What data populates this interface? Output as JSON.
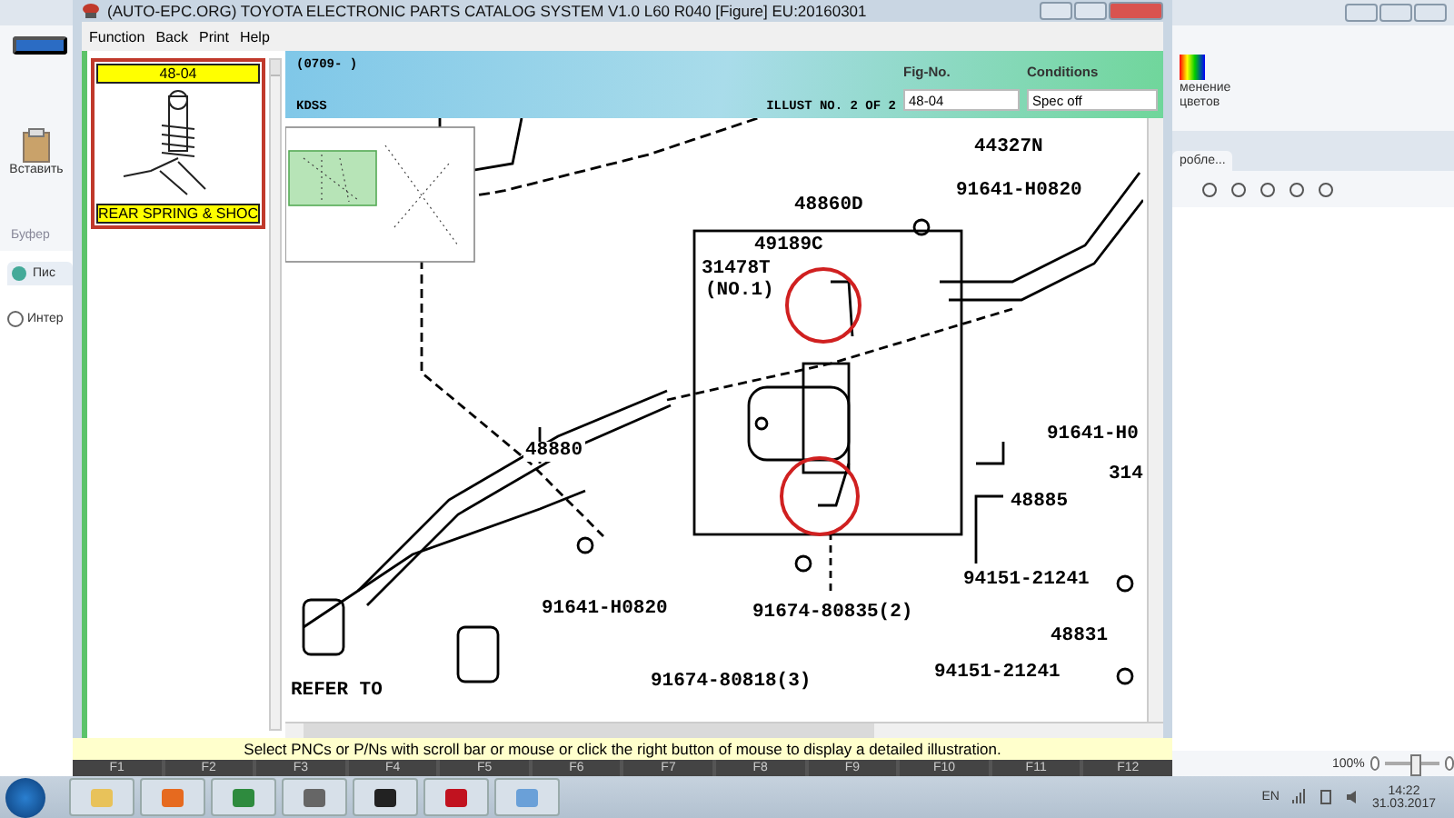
{
  "background_left": {
    "paste_label": "Вставить",
    "clipboard_label": "Буфер",
    "tab_label": "Пис",
    "address_label": "Интер"
  },
  "window": {
    "title": "(AUTO-EPC.ORG) TOYOTA ELECTRONIC PARTS CATALOG SYSTEM V1.0 L60 R040 [Figure] EU:20160301"
  },
  "menu": [
    "Function",
    "Back",
    "Print",
    "Help"
  ],
  "thumbnail": {
    "code": "48-04",
    "caption": "REAR SPRING & SHOC",
    "selected": true
  },
  "header": {
    "range": "(0709-     )",
    "model": "KDSS",
    "illust": "ILLUST NO. 2 OF 2",
    "fig_label": "Fig-No.",
    "fig_value": "48-04",
    "cond_label": "Conditions",
    "cond_value": "Spec off"
  },
  "callouts": [
    "44327N",
    "91641-H0820",
    "48860D",
    "49189C",
    "31478T",
    "(NO.1)",
    "91641-H0",
    "314",
    "48885",
    "48880",
    "91641-H0820",
    "91674-80835(2)",
    "94151-21241",
    "48831",
    "94151-21241",
    "91674-80818(3)",
    "REFER TO"
  ],
  "status_bar": "Select PNCs or P/Ns with scroll bar or mouse or click the right button of mouse to display a detailed illustration.",
  "function_keys": [
    "F1",
    "F2",
    "F3",
    "F4",
    "F5",
    "F6",
    "F7",
    "F8",
    "F9",
    "F10",
    "F11",
    "F12"
  ],
  "background_right": {
    "ribbon_label_1": "менение",
    "ribbon_label_2": "цветов",
    "tab_label": "робле...",
    "zoom": "100%",
    "level": 0.55
  },
  "taskbar": {
    "lang": "EN",
    "time": "14:22",
    "date": "31.03.2017"
  }
}
